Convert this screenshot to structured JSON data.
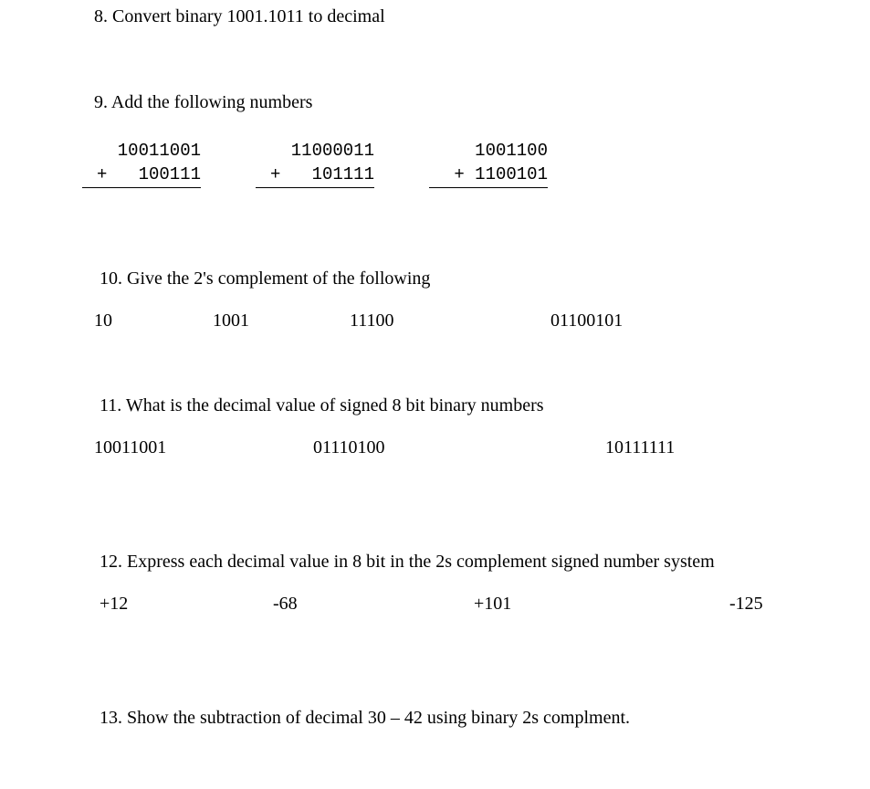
{
  "q8": {
    "prompt": "8. Convert binary 1001.1011 to decimal"
  },
  "q9": {
    "prompt": "9. Add the following numbers",
    "cols": [
      {
        "top": "10011001",
        "bot": "100111"
      },
      {
        "top": "11000011",
        "bot": "101111"
      },
      {
        "top": "1001100",
        "bot": "1100101"
      }
    ]
  },
  "q10": {
    "prompt": "10. Give the 2's complement of the following",
    "items": [
      "10",
      "1001",
      "11100",
      "01100101"
    ]
  },
  "q11": {
    "prompt": "11. What is the decimal value of signed 8 bit binary numbers",
    "items": [
      "10011001",
      "01110100",
      "10111111"
    ]
  },
  "q12": {
    "prompt": "12. Express each decimal value in 8 bit in the 2s complement signed number system",
    "items": [
      "+12",
      "-68",
      "+101",
      "-125"
    ]
  },
  "q13": {
    "prompt": "13. Show the subtraction of  decimal  30 – 42  using binary  2s complment."
  }
}
